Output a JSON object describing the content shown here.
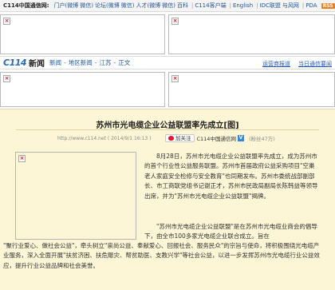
{
  "topbar": {
    "site_name": "C114中国通信网:",
    "nav": [
      "门户(微博",
      "微信)",
      "论坛(微博",
      "微信)",
      "人才(微博",
      "微信)",
      "百科",
      "C114客户端",
      "English",
      "IDC联盟",
      "与风网",
      "PDA"
    ],
    "rss_label": "RSS"
  },
  "section": {
    "logo": "C114",
    "logo_news": "新闻",
    "breadcrumb": [
      "新闻",
      "地区新闻",
      "江苏",
      "正文"
    ],
    "links": [
      "运营商报道",
      "当日通信要闻"
    ]
  },
  "article": {
    "title": "苏州市光电缆企业公益联盟率先成立[图]",
    "meta": "http://www.c114.net  ( 2014/9/1 16:13 )",
    "follow_label": "加关注",
    "account_name": "C114中国通信网",
    "verified_mark": "V",
    "fans": "(粉丝47万)",
    "paragraph1": "8月28日，苏州市光电缆企业公益联盟率先成立，成为苏州市的首个行业性公益服务联盟。苏州市首届政府公益采购项目\"空巢老人家庭安全检修与安全教育\"也同期发布。苏州市委统战部副部长、市工商联党组书记谢正才，苏州市民政局副局长陈韩益等领导出席，并为\"苏州市光电缆企业公益联盟\"揭牌。",
    "paragraph2": "\"苏州市光电缆企业公益联盟\"是在苏州市光电缆业商会的倡导下，由全市100多家光电缆企业联合成立。旨在",
    "paragraph3": "\"聚行业爱心、做社会公益\"，牵头树立\"崇尚公益、奉献爱心、回报社会、服务民众\"的宗旨与使命，将积极围绕光电缆产业服务，深入全面开展\"扶贫济困、扶危赈灾、帮贫助医、支教兴学\"等社会公益，以进一步发挥苏州市光电缆行业公益效应，提升行业公益品牌和社会美誉。"
  },
  "colors": {
    "article_bg": "#fdf6d6",
    "link_blue": "#225599",
    "rss_orange": "#f07d1a"
  }
}
